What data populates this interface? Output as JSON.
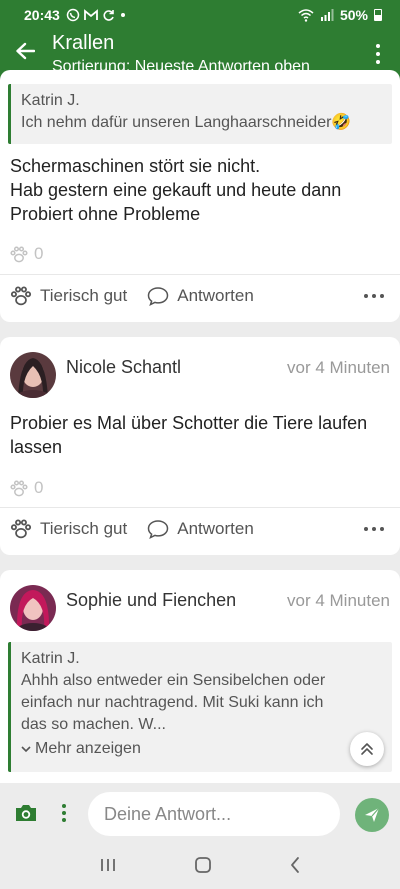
{
  "status_bar": {
    "time": "20:43",
    "battery": "50%",
    "notification_icons": [
      "call-icon",
      "mail-icon",
      "sync-icon",
      "dot-icon"
    ],
    "system_icons": [
      "wifi-icon",
      "signal-icon",
      "battery-icon"
    ]
  },
  "app_bar": {
    "title": "Krallen",
    "subtitle": "Sortierung: Neueste Antworten oben"
  },
  "posts": [
    {
      "quote": {
        "author": "Katrin J.",
        "text": "Ich nehm dafür unseren Langhaarschneider🤣"
      },
      "text_lines": [
        "Schermaschinen stört sie nicht.",
        "Hab gestern eine gekauft und heute dann",
        "Probiert ohne Probleme"
      ],
      "likes": "0",
      "like_label": "Tierisch gut",
      "reply_label": "Antworten"
    },
    {
      "author": "Nicole Schantl",
      "time": "vor 4 Minuten",
      "text": "Probier es Mal über Schotter die Tiere laufen lassen",
      "likes": "0",
      "like_label": "Tierisch gut",
      "reply_label": "Antworten"
    },
    {
      "author": "Sophie und Fienchen",
      "time": "vor 4 Minuten",
      "quote": {
        "author": "Katrin J.",
        "text": "Ahhh also entweder ein Sensibelchen oder einfach nur nachtragend. Mit Suki kann ich das so machen. W...",
        "more_label": "Mehr anzeigen"
      }
    }
  ],
  "composer": {
    "placeholder": "Deine Antwort..."
  },
  "colors": {
    "brand": "#2e7d32",
    "send_button": "#6fb37a"
  }
}
